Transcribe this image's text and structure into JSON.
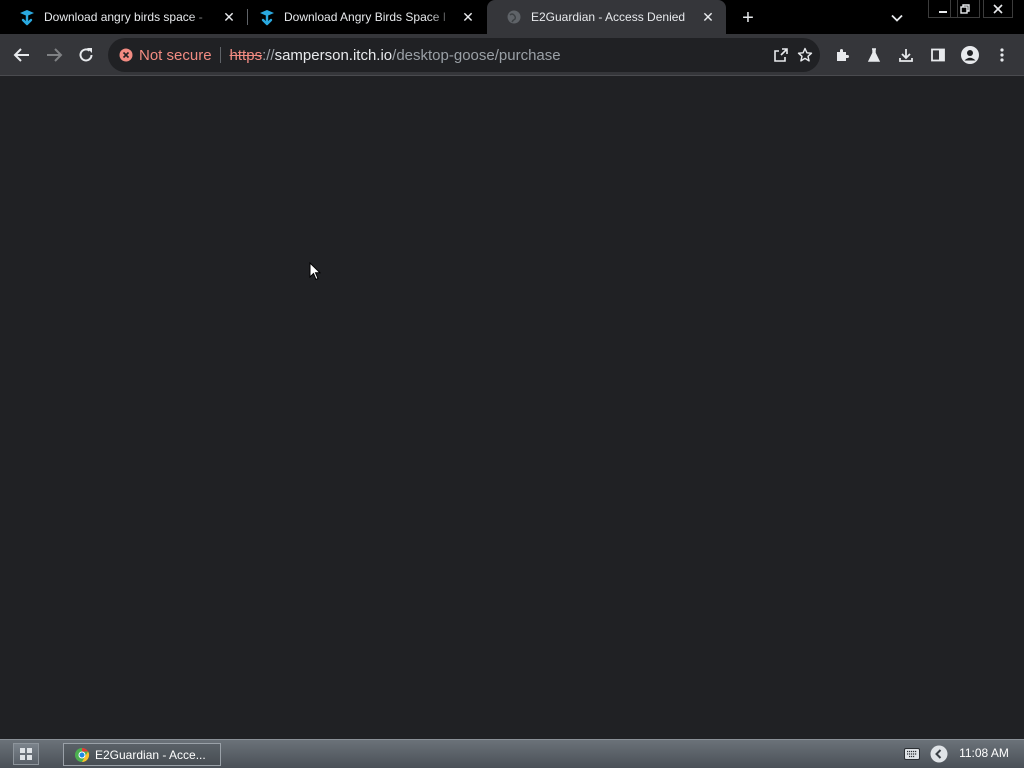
{
  "browser": {
    "tabs": [
      {
        "title": "Download angry birds space - ",
        "state": "inactive",
        "favicon": "itch-download-icon"
      },
      {
        "title": "Download Angry Birds Space I",
        "state": "inactive",
        "favicon": "itch-download-icon"
      },
      {
        "title": "E2Guardian - Access Denied",
        "state": "active",
        "favicon": "globe-icon"
      }
    ],
    "new_tab_symbol": "+",
    "close_symbol": "✕",
    "omnibox": {
      "security_label": "Not secure",
      "url_scheme": "https",
      "url_sep": "://",
      "url_host": "samperson.itch.io",
      "url_path": "/desktop-goose/purchase"
    }
  },
  "taskbar": {
    "task_label": "E2Guardian - Acce...",
    "clock": "11:08 AM"
  },
  "colors": {
    "page_bg": "#202124",
    "toolbar_bg": "#35363a",
    "tabstrip_bg": "#000000",
    "insecure_red": "#f28b82",
    "favicon_blue": "#2aa9e0"
  }
}
